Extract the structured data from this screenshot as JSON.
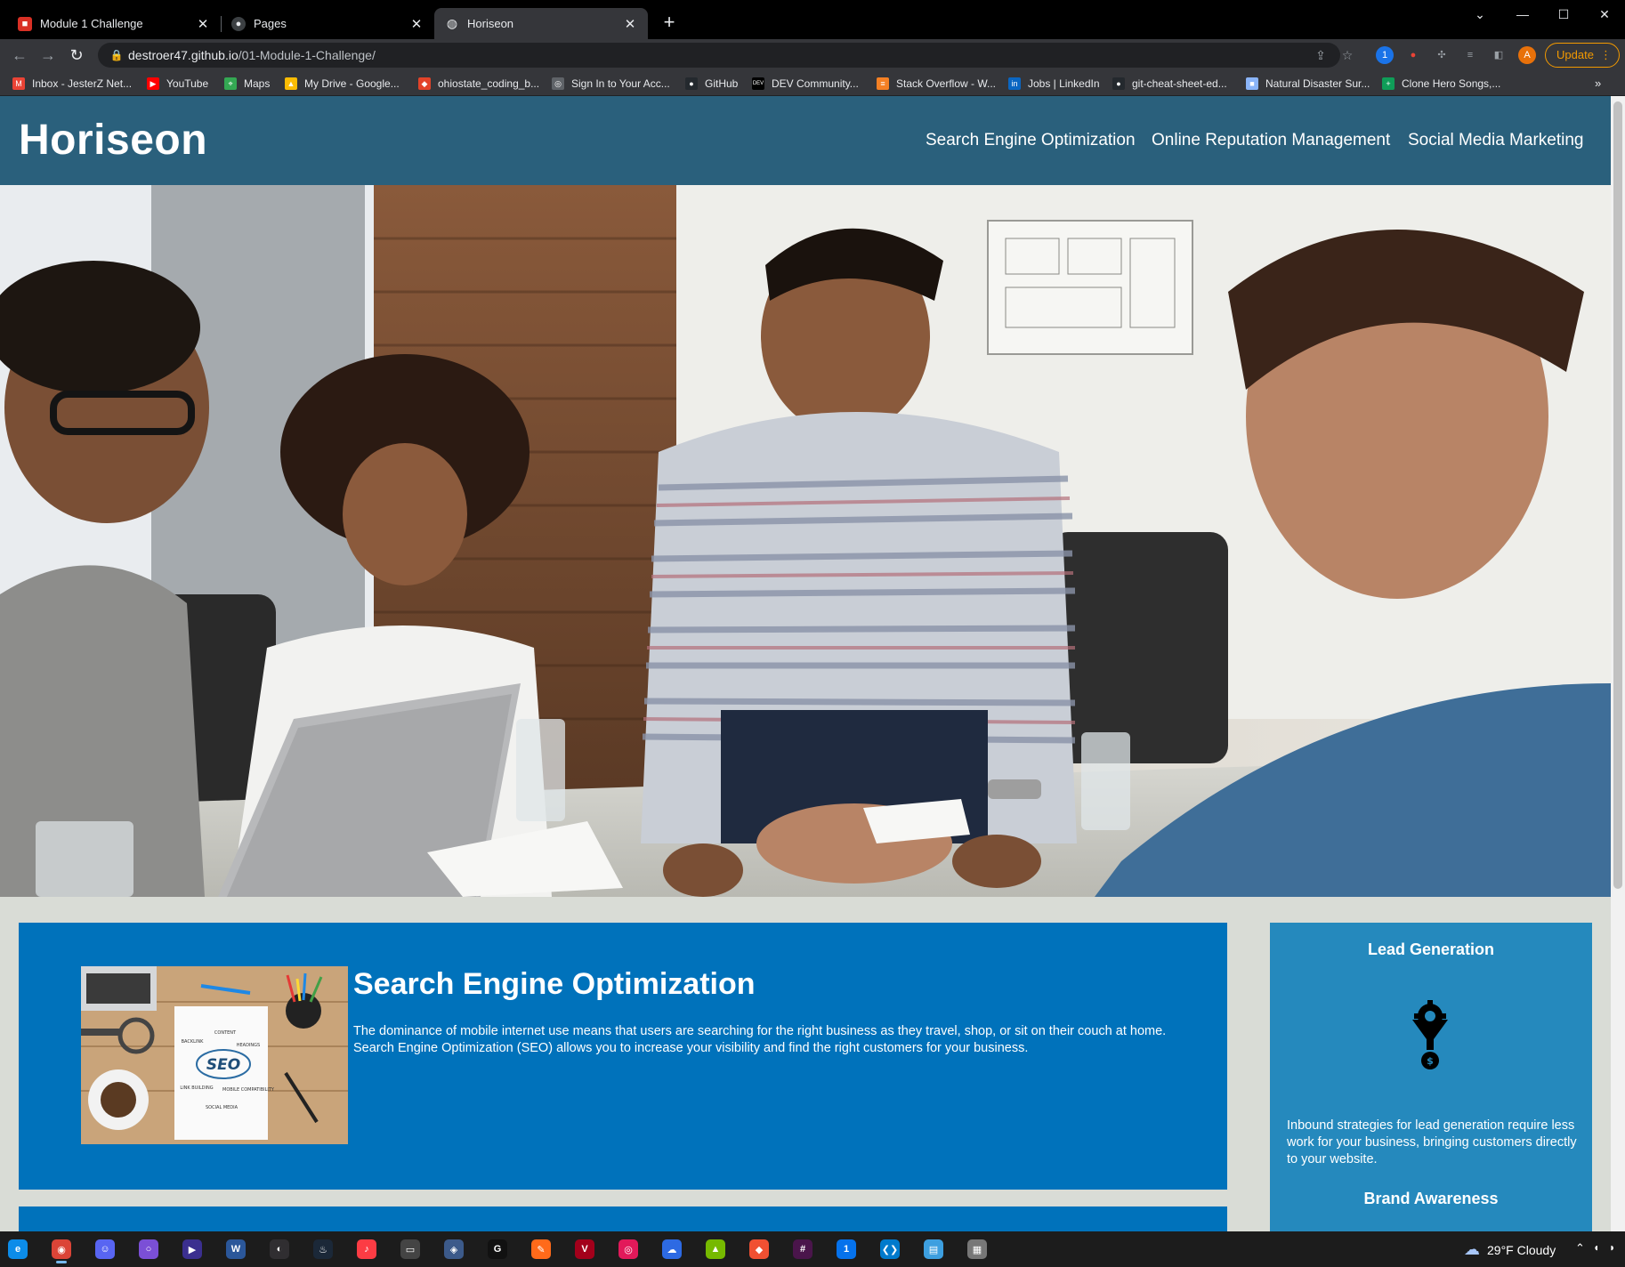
{
  "browser": {
    "tabs": [
      {
        "title": "Module 1 Challenge",
        "icon": "red-square-icon",
        "active": false
      },
      {
        "title": "Pages",
        "icon": "github-icon",
        "active": false
      },
      {
        "title": "Horiseon",
        "icon": "globe-icon",
        "active": true
      }
    ],
    "new_tab": "+",
    "window": {
      "minimize": "—",
      "maximize": "☐",
      "close": "✕",
      "dropdown": "⌄"
    },
    "url_host": "destroer47.github.io",
    "url_path": "/01-Module-1-Challenge/",
    "profile_initial": "A",
    "update_label": "Update",
    "bookmarks": [
      {
        "label": "Inbox - JesterZ Net...",
        "icon": "gmail-icon",
        "color": "#ea4335",
        "glyph": "M"
      },
      {
        "label": "YouTube",
        "icon": "youtube-icon",
        "color": "#ff0000",
        "glyph": "▶"
      },
      {
        "label": "Maps",
        "icon": "maps-icon",
        "color": "#34a853",
        "glyph": "⌖"
      },
      {
        "label": "My Drive - Google...",
        "icon": "drive-icon",
        "color": "#fbbc04",
        "glyph": "▲"
      },
      {
        "label": "ohiostate_coding_b...",
        "icon": "gitlab-icon",
        "color": "#e24329",
        "glyph": "◆"
      },
      {
        "label": "Sign In to Your Acc...",
        "icon": "globe-icon",
        "color": "#5f6368",
        "glyph": "◎"
      },
      {
        "label": "GitHub",
        "icon": "github-icon",
        "color": "#24292e",
        "glyph": "●"
      },
      {
        "label": "DEV Community...",
        "icon": "dev-icon",
        "color": "#000000",
        "glyph": "DEV"
      },
      {
        "label": "Stack Overflow - W...",
        "icon": "stackoverflow-icon",
        "color": "#f48024",
        "glyph": "≡"
      },
      {
        "label": "Jobs | LinkedIn",
        "icon": "linkedin-icon",
        "color": "#0a66c2",
        "glyph": "in"
      },
      {
        "label": "git-cheat-sheet-ed...",
        "icon": "github-icon",
        "color": "#24292e",
        "glyph": "●"
      },
      {
        "label": "Natural Disaster Sur...",
        "icon": "bookmark-page-icon",
        "color": "#8ab4f8",
        "glyph": "■"
      },
      {
        "label": "Clone Hero Songs,...",
        "icon": "sheets-icon",
        "color": "#0f9d58",
        "glyph": "+"
      }
    ],
    "bookmarks_more": "»"
  },
  "site": {
    "logo": "Horiseon",
    "nav": [
      "Search Engine Optimization",
      "Online Reputation Management",
      "Social Media Marketing"
    ],
    "section": {
      "title": "Search Engine Optimization",
      "text": "The dominance of mobile internet use means that users are searching for the right business as they travel, shop, or sit on their couch at home. Search Engine Optimization (SEO) allows you to increase your visibility and find the right customers for your business.",
      "thumb_words": {
        "center": "SEO",
        "content": "CONTENT",
        "backlink": "BACKLINK",
        "headings": "HEADINGS",
        "link_building": "LINK BUILDING",
        "mobile": "MOBILE COMPATIBILITY",
        "social": "SOCIAL MEDIA"
      }
    },
    "aside": {
      "lead_title": "Lead Generation",
      "lead_text": "Inbound strategies for lead generation require less work for your business, bringing customers directly to your website.",
      "brand_title": "Brand Awareness"
    },
    "colors": {
      "header": "#2a607c",
      "card": "#0072bb",
      "aside": "#2589bd",
      "page_bg": "#d9dcd6"
    }
  },
  "taskbar": {
    "apps": [
      {
        "name": "edge",
        "icon": "edge-icon",
        "color": "#0c8ce9",
        "glyph": "e"
      },
      {
        "name": "chrome",
        "icon": "chrome-icon",
        "color": "#db4437",
        "glyph": "◉",
        "active": true
      },
      {
        "name": "discord",
        "icon": "discord-icon",
        "color": "#5865f2",
        "glyph": "☺"
      },
      {
        "name": "overwolf",
        "icon": "circle-app-icon",
        "color": "#7b4fd6",
        "glyph": "○"
      },
      {
        "name": "terminal",
        "icon": "play-app-icon",
        "color": "#3b2f8f",
        "glyph": "▶"
      },
      {
        "name": "word",
        "icon": "word-icon",
        "color": "#2b579a",
        "glyph": "W"
      },
      {
        "name": "obs",
        "icon": "obs-icon",
        "color": "#302e31",
        "glyph": "◐"
      },
      {
        "name": "steam",
        "icon": "steam-icon",
        "color": "#1b2838",
        "glyph": "♨"
      },
      {
        "name": "itunes",
        "icon": "music-icon",
        "color": "#fc3c44",
        "glyph": "♪"
      },
      {
        "name": "cardapp",
        "icon": "card-app-icon",
        "color": "#444444",
        "glyph": "▭"
      },
      {
        "name": "vpn",
        "icon": "vpn-icon",
        "color": "#3c5a8a",
        "glyph": "◈"
      },
      {
        "name": "ghub",
        "icon": "logitech-icon",
        "color": "#111111",
        "glyph": "G"
      },
      {
        "name": "pen",
        "icon": "pen-app-icon",
        "color": "#ff6a1a",
        "glyph": "✎"
      },
      {
        "name": "vegas",
        "icon": "vegas-icon",
        "color": "#a3001b",
        "glyph": "V"
      },
      {
        "name": "record",
        "icon": "record-icon",
        "color": "#e2195a",
        "glyph": "◎"
      },
      {
        "name": "cloud",
        "icon": "cloud-app-icon",
        "color": "#2d6ae3",
        "glyph": "☁"
      },
      {
        "name": "nvidia",
        "icon": "nvidia-icon",
        "color": "#76b900",
        "glyph": "▲"
      },
      {
        "name": "git",
        "icon": "git-icon",
        "color": "#f05032",
        "glyph": "◆"
      },
      {
        "name": "slack",
        "icon": "slack-icon",
        "color": "#4a154b",
        "glyph": "#"
      },
      {
        "name": "1password",
        "icon": "1password-icon",
        "color": "#0572ec",
        "glyph": "1"
      },
      {
        "name": "vscode",
        "icon": "vscode-icon",
        "color": "#007acc",
        "glyph": "❮❯"
      },
      {
        "name": "notes",
        "icon": "notes-icon",
        "color": "#3d9fe0",
        "glyph": "▤"
      },
      {
        "name": "device",
        "icon": "device-icon",
        "color": "#777777",
        "glyph": "▦"
      }
    ],
    "weather": "29°F  Cloudy",
    "tray": {
      "chevron": "⌃",
      "mic": "🎤",
      "volume": "🔊"
    }
  }
}
